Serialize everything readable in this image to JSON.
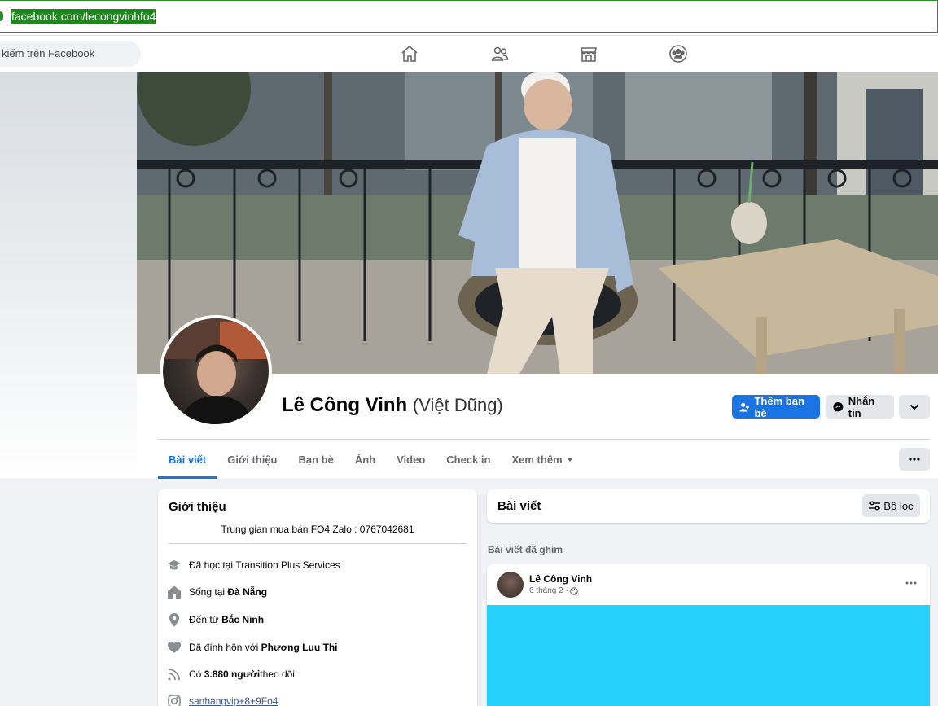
{
  "browser": {
    "url": "facebook.com/lecongvinhfo4"
  },
  "topnav": {
    "search_placeholder": "kiếm trên Facebook",
    "icons": [
      "home-icon",
      "friends-icon",
      "marketplace-icon",
      "groups-icon"
    ]
  },
  "profile": {
    "name": "Lê Công Vinh",
    "alt_name": "(Việt Dũng)",
    "add_friend_label": "Thêm bạn bè",
    "message_label": "Nhắn tin"
  },
  "tabs": [
    "Bài viết",
    "Giới thiệu",
    "Bạn bè",
    "Ảnh",
    "Video",
    "Check in",
    "Xem thêm"
  ],
  "intro": {
    "title": "Giới thiệu",
    "bio": "Trung gian mua bán FO4 Zalo : 0767042681",
    "studied_prefix": "Đã học tại ",
    "studied_value": "Transition Plus Services",
    "lives_prefix": "Sống tại ",
    "lives_value": "Đà Nẵng",
    "from_prefix": "Đến từ ",
    "from_value": "Bắc Ninh",
    "engaged_prefix": "Đã đính hôn với ",
    "engaged_value": "Phương Luu Thi",
    "followers_prefix": "Có ",
    "followers_value": "3.880 người",
    "followers_suffix": " theo dõi",
    "instagram": "sanhangvip+8+9Fo4"
  },
  "posts": {
    "title": "Bài viết",
    "filter_label": "Bộ lọc",
    "pinned_label": "Bài viết đã ghim",
    "first_post": {
      "author": "Lê Công Vinh",
      "time": "6 tháng 2 ·",
      "image_color": "#25d2fb"
    }
  },
  "colors": {
    "accent": "#1b74e4",
    "url_highlight": "#1b8a1b"
  }
}
